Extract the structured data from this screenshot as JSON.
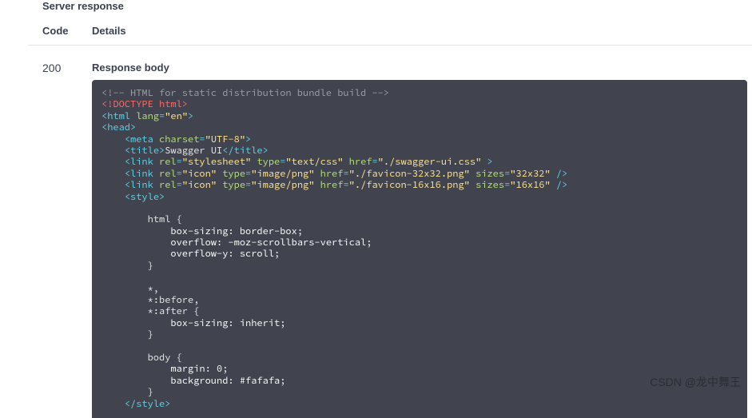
{
  "section_title": "Server response",
  "headers": {
    "code": "Code",
    "details": "Details"
  },
  "row": {
    "code": "200",
    "response_body_label": "Response body"
  },
  "code_tokens": [
    {
      "cls": "c-comment",
      "t": "<!-- HTML for static distribution bundle build -->"
    },
    {
      "nl": true
    },
    {
      "cls": "c-doctype",
      "t": "<!DOCTYPE html>"
    },
    {
      "nl": true
    },
    {
      "cls": "c-tag",
      "t": "<html "
    },
    {
      "cls": "c-attr",
      "t": "lang"
    },
    {
      "cls": "c-tag",
      "t": "="
    },
    {
      "cls": "c-string",
      "t": "\"en\""
    },
    {
      "cls": "c-tag",
      "t": ">"
    },
    {
      "nl": true
    },
    {
      "cls": "c-tag",
      "t": "<head>"
    },
    {
      "nl": true
    },
    {
      "cls": "c-plain",
      "t": "    "
    },
    {
      "cls": "c-tag",
      "t": "<meta "
    },
    {
      "cls": "c-attr",
      "t": "charset"
    },
    {
      "cls": "c-tag",
      "t": "="
    },
    {
      "cls": "c-string",
      "t": "\"UTF-8\""
    },
    {
      "cls": "c-tag",
      "t": ">"
    },
    {
      "nl": true
    },
    {
      "cls": "c-plain",
      "t": "    "
    },
    {
      "cls": "c-tag",
      "t": "<title>"
    },
    {
      "cls": "c-plain",
      "t": "Swagger UI"
    },
    {
      "cls": "c-tag",
      "t": "</title>"
    },
    {
      "nl": true
    },
    {
      "cls": "c-plain",
      "t": "    "
    },
    {
      "cls": "c-tag",
      "t": "<link "
    },
    {
      "cls": "c-attr",
      "t": "rel"
    },
    {
      "cls": "c-tag",
      "t": "="
    },
    {
      "cls": "c-string",
      "t": "\"stylesheet\""
    },
    {
      "cls": "c-plain",
      "t": " "
    },
    {
      "cls": "c-attr",
      "t": "type"
    },
    {
      "cls": "c-tag",
      "t": "="
    },
    {
      "cls": "c-string",
      "t": "\"text/css\""
    },
    {
      "cls": "c-plain",
      "t": " "
    },
    {
      "cls": "c-attr",
      "t": "href"
    },
    {
      "cls": "c-tag",
      "t": "="
    },
    {
      "cls": "c-string",
      "t": "\"./swagger-ui.css\""
    },
    {
      "cls": "c-tag",
      "t": " >"
    },
    {
      "nl": true
    },
    {
      "cls": "c-plain",
      "t": "    "
    },
    {
      "cls": "c-tag",
      "t": "<link "
    },
    {
      "cls": "c-attr",
      "t": "rel"
    },
    {
      "cls": "c-tag",
      "t": "="
    },
    {
      "cls": "c-string",
      "t": "\"icon\""
    },
    {
      "cls": "c-plain",
      "t": " "
    },
    {
      "cls": "c-attr",
      "t": "type"
    },
    {
      "cls": "c-tag",
      "t": "="
    },
    {
      "cls": "c-string",
      "t": "\"image/png\""
    },
    {
      "cls": "c-plain",
      "t": " "
    },
    {
      "cls": "c-attr",
      "t": "href"
    },
    {
      "cls": "c-tag",
      "t": "="
    },
    {
      "cls": "c-string",
      "t": "\"./favicon-32x32.png\""
    },
    {
      "cls": "c-plain",
      "t": " "
    },
    {
      "cls": "c-attr",
      "t": "sizes"
    },
    {
      "cls": "c-tag",
      "t": "="
    },
    {
      "cls": "c-string",
      "t": "\"32x32\""
    },
    {
      "cls": "c-tag",
      "t": " />"
    },
    {
      "nl": true
    },
    {
      "cls": "c-plain",
      "t": "    "
    },
    {
      "cls": "c-tag",
      "t": "<link "
    },
    {
      "cls": "c-attr",
      "t": "rel"
    },
    {
      "cls": "c-tag",
      "t": "="
    },
    {
      "cls": "c-string",
      "t": "\"icon\""
    },
    {
      "cls": "c-plain",
      "t": " "
    },
    {
      "cls": "c-attr",
      "t": "type"
    },
    {
      "cls": "c-tag",
      "t": "="
    },
    {
      "cls": "c-string",
      "t": "\"image/png\""
    },
    {
      "cls": "c-plain",
      "t": " "
    },
    {
      "cls": "c-attr",
      "t": "href"
    },
    {
      "cls": "c-tag",
      "t": "="
    },
    {
      "cls": "c-string",
      "t": "\"./favicon-16x16.png\""
    },
    {
      "cls": "c-plain",
      "t": " "
    },
    {
      "cls": "c-attr",
      "t": "sizes"
    },
    {
      "cls": "c-tag",
      "t": "="
    },
    {
      "cls": "c-string",
      "t": "\"16x16\""
    },
    {
      "cls": "c-tag",
      "t": " />"
    },
    {
      "nl": true
    },
    {
      "cls": "c-plain",
      "t": "    "
    },
    {
      "cls": "c-tag",
      "t": "<style>"
    },
    {
      "nl": true
    },
    {
      "nl": true
    },
    {
      "cls": "c-plain",
      "t": "        html {"
    },
    {
      "nl": true
    },
    {
      "cls": "c-plain",
      "t": "            "
    },
    {
      "cls": "c-prop",
      "t": "box-sizing"
    },
    {
      "cls": "c-plain",
      "t": ": "
    },
    {
      "cls": "c-val",
      "t": "border-box"
    },
    {
      "cls": "c-plain",
      "t": ";"
    },
    {
      "nl": true
    },
    {
      "cls": "c-plain",
      "t": "            "
    },
    {
      "cls": "c-prop",
      "t": "overflow"
    },
    {
      "cls": "c-plain",
      "t": ": "
    },
    {
      "cls": "c-val",
      "t": "-moz-scrollbars-vertical"
    },
    {
      "cls": "c-plain",
      "t": ";"
    },
    {
      "nl": true
    },
    {
      "cls": "c-plain",
      "t": "            "
    },
    {
      "cls": "c-prop",
      "t": "overflow-y"
    },
    {
      "cls": "c-plain",
      "t": ": "
    },
    {
      "cls": "c-val",
      "t": "scroll"
    },
    {
      "cls": "c-plain",
      "t": ";"
    },
    {
      "nl": true
    },
    {
      "cls": "c-plain",
      "t": "        }"
    },
    {
      "nl": true
    },
    {
      "nl": true
    },
    {
      "cls": "c-plain",
      "t": "        *,"
    },
    {
      "nl": true
    },
    {
      "cls": "c-plain",
      "t": "        *:before,"
    },
    {
      "nl": true
    },
    {
      "cls": "c-plain",
      "t": "        *:after {"
    },
    {
      "nl": true
    },
    {
      "cls": "c-plain",
      "t": "            "
    },
    {
      "cls": "c-prop",
      "t": "box-sizing"
    },
    {
      "cls": "c-plain",
      "t": ": "
    },
    {
      "cls": "c-val",
      "t": "inherit"
    },
    {
      "cls": "c-plain",
      "t": ";"
    },
    {
      "nl": true
    },
    {
      "cls": "c-plain",
      "t": "        }"
    },
    {
      "nl": true
    },
    {
      "nl": true
    },
    {
      "cls": "c-plain",
      "t": "        body {"
    },
    {
      "nl": true
    },
    {
      "cls": "c-plain",
      "t": "            "
    },
    {
      "cls": "c-prop",
      "t": "margin"
    },
    {
      "cls": "c-plain",
      "t": ": "
    },
    {
      "cls": "c-val",
      "t": "0"
    },
    {
      "cls": "c-plain",
      "t": ";"
    },
    {
      "nl": true
    },
    {
      "cls": "c-plain",
      "t": "            "
    },
    {
      "cls": "c-prop",
      "t": "background"
    },
    {
      "cls": "c-plain",
      "t": ": "
    },
    {
      "cls": "c-val",
      "t": "#fafafa"
    },
    {
      "cls": "c-plain",
      "t": ";"
    },
    {
      "nl": true
    },
    {
      "cls": "c-plain",
      "t": "        }"
    },
    {
      "nl": true
    },
    {
      "cls": "c-plain",
      "t": "    "
    },
    {
      "cls": "c-tag",
      "t": "</style>"
    }
  ],
  "watermark": "CSDN @龙中舞王"
}
